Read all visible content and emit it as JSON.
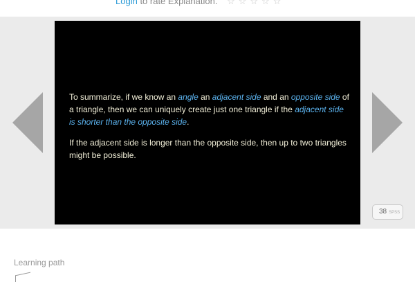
{
  "rating": {
    "login_label": "Login",
    "text": "to rate Explanation.",
    "stars": "☆☆☆☆☆"
  },
  "navigation": {
    "prev_icon": "triangle-left-icon",
    "next_icon": "triangle-right-icon"
  },
  "slide": {
    "p1": {
      "t1": "To summarize, if we know an ",
      "h1": "angle",
      "t2": " an ",
      "h2": "adjacent side",
      "t3": " and an ",
      "h3": "opposite side",
      "t4": " of a triangle, then we can uniquely create just one triangle if the ",
      "h4": "adjacent side is shorter than the opposite side",
      "t5": "."
    },
    "p2": "If the adjacent side is longer than the opposite side, then up to two triangles might be possible."
  },
  "page_badge": {
    "number": "38",
    "suffix": "SPSS"
  },
  "learning_path": {
    "label": "Learning path"
  },
  "colors": {
    "link": "#2a9ad6",
    "highlight": "#5cb4f0",
    "slide_text": "#f2efd8",
    "arrow": "#a6a6a6"
  }
}
